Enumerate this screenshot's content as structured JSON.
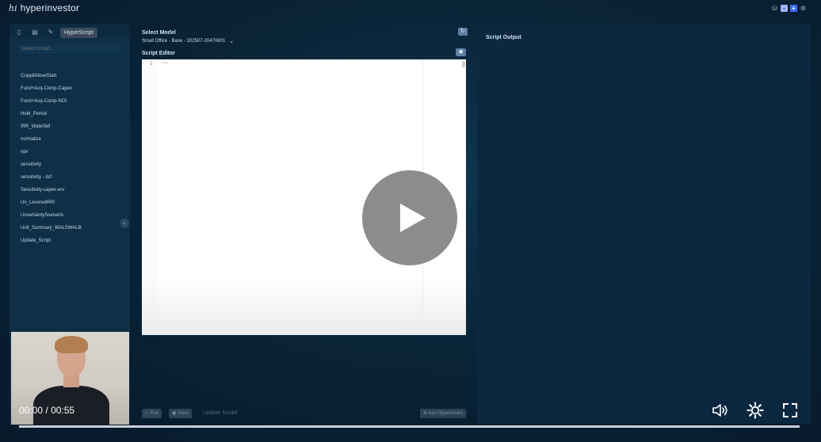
{
  "app": {
    "logo_mark": "hi",
    "name": "hyperinvestor",
    "top_right_icons": [
      "database-icon",
      "minus-icon",
      "plus-icon",
      "gear-icon"
    ],
    "top_buttons": {
      "minus": "-",
      "plus": "+"
    }
  },
  "left_panel": {
    "tabs": [
      {
        "icon": "file-icon",
        "glyph": "▯"
      },
      {
        "icon": "table-icon",
        "glyph": "▤"
      },
      {
        "icon": "script-icon",
        "glyph": "✎"
      }
    ],
    "active_tab_label": "HyperScript",
    "search_placeholder": "Search Script...",
    "scripts": [
      "Copy&MoveStart",
      "Fund+Acq-Comp-Capex",
      "Fund+Acq-Comp-NOI",
      "Hold_Period",
      "IRR_Waterfall",
      "normalize",
      "npv",
      "sensitivity",
      "sensitivity - dcf",
      "Sensitivity-capex-erv",
      "Un_LeveredIRR",
      "UncertaintyScenario",
      "Unit_Summary_WALSWALB",
      "Update_Script"
    ],
    "collapse_glyph": "‹"
  },
  "middle_panel": {
    "select_model_label": "Select Model",
    "selected_model": "Small Office - Base - 202507-20470601",
    "chevron": "⌄",
    "script_editor_label": "Script Editor",
    "line_number": "1",
    "code_text": "new",
    "refresh_glyph": "↻",
    "eye_glyph": "👁",
    "buttons": {
      "run": "▷ Run",
      "save": "▣ Save",
      "update_model": "Update Model",
      "ask": "⊕ Ask HyperAssist"
    }
  },
  "right_panel": {
    "output_label": "Script Output"
  },
  "video": {
    "current_time": "00:00",
    "separator": "/",
    "duration": "00:55",
    "progress": 0,
    "accent": "#ffffff"
  }
}
